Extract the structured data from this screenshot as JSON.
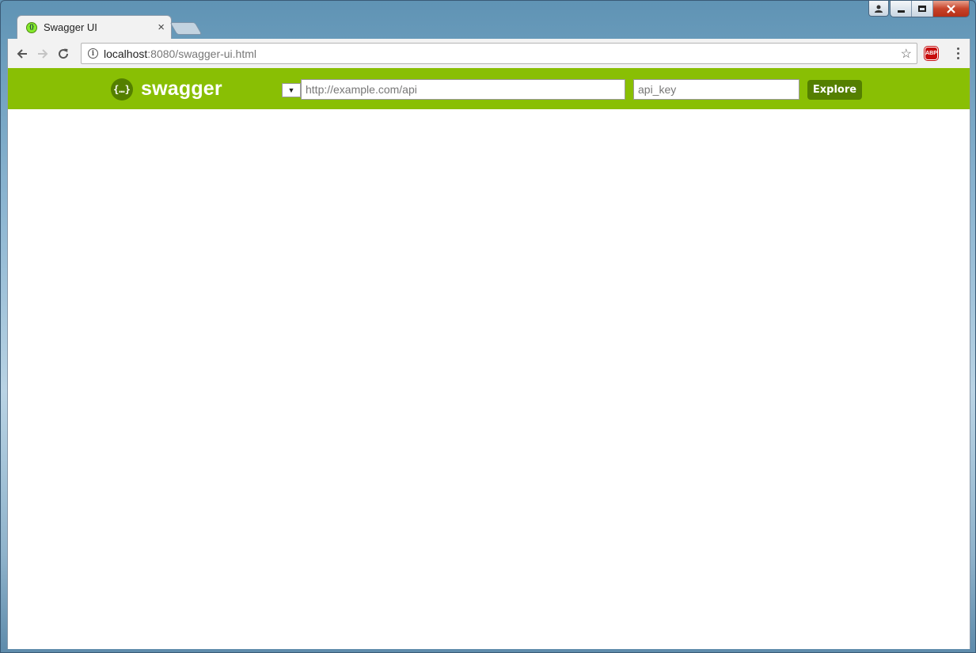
{
  "browser": {
    "tab_title": "Swagger UI",
    "tab_close": "×",
    "url_host": "localhost",
    "url_path": ":8080/swagger-ui.html",
    "extension_label": "ABP"
  },
  "swagger": {
    "logo_text": "swagger",
    "logo_glyph": "{…}",
    "select_glyph": "▼",
    "url_placeholder": "http://example.com/api",
    "api_key_placeholder": "api_key",
    "explore_label": "Explore"
  },
  "colors": {
    "header_bg": "#89bf04",
    "explore_bg": "#547f00"
  }
}
